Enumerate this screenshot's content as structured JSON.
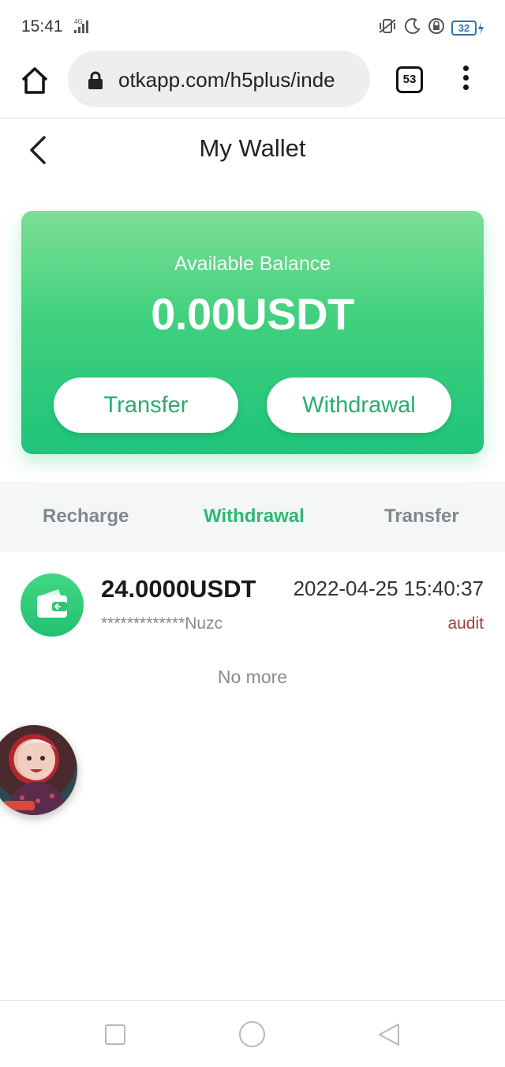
{
  "status_bar": {
    "time": "15:41",
    "network": "4G",
    "battery": "32"
  },
  "browser": {
    "url": "otkapp.com/h5plus/inde",
    "tab_count": "53",
    "icons": [
      "home-icon",
      "lock-icon",
      "tabs-icon",
      "menu-icon"
    ]
  },
  "header": {
    "title": "My Wallet"
  },
  "wallet": {
    "balance_label": "Available Balance",
    "balance_value": "0.00USDT",
    "transfer_button": "Transfer",
    "withdrawal_button": "Withdrawal"
  },
  "tabs": [
    {
      "label": "Recharge",
      "active": false
    },
    {
      "label": "Withdrawal",
      "active": true
    },
    {
      "label": "Transfer",
      "active": false
    }
  ],
  "records": [
    {
      "amount": "24.0000USDT",
      "time": "2022-04-25 15:40:37",
      "account": "*************Nuzc",
      "status": "audit",
      "icon": "wallet-icon"
    }
  ],
  "list_end_text": "No more",
  "colors": {
    "accent": "#2cb872",
    "card_gradient_top": "#7ddf95",
    "card_gradient_bottom": "#1ec47b",
    "status_audit": "#a0403a"
  }
}
